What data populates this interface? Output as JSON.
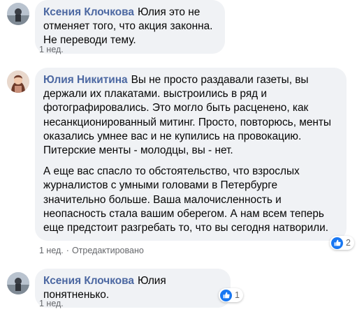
{
  "comments": [
    {
      "author": "Ксения Клочкова",
      "text": "Юлия это не отменяет того, что акция законна. Не переводи тему.",
      "time": "1 нед."
    },
    {
      "author": "Юлия Никитина",
      "text": "Вы не просто раздавали газеты, вы держали их плакатами. выстроились в ряд и фотографировались. Это могло быть расценено, как несанкционированный митинг. Просто, повторюсь, менты оказались умнее вас и не купились на провокацию. Питерские менты - молодцы, вы - нет.",
      "text2": "А еще вас спасло то обстоятельство, что взрослых журналистов с умными головами в Петербурге значительно больше. Ваша малочисленность и неопасность стала вашим оберегом. А нам всем теперь еще предстоит разгребать то, что вы сегодня натворили.",
      "time": "1 нед.",
      "separator": "·",
      "edited": "Отредактировано",
      "reactions": "2"
    },
    {
      "author": "Ксения Клочкова",
      "text": "Юлия понятненько.",
      "time": "1 нед.",
      "reactions": "1"
    }
  ],
  "colors": {
    "author": "#4b67a1",
    "bubble": "#f0f2f5",
    "meta": "#65676b",
    "like": "#1877f2"
  },
  "icons": {
    "like": "like-icon"
  }
}
